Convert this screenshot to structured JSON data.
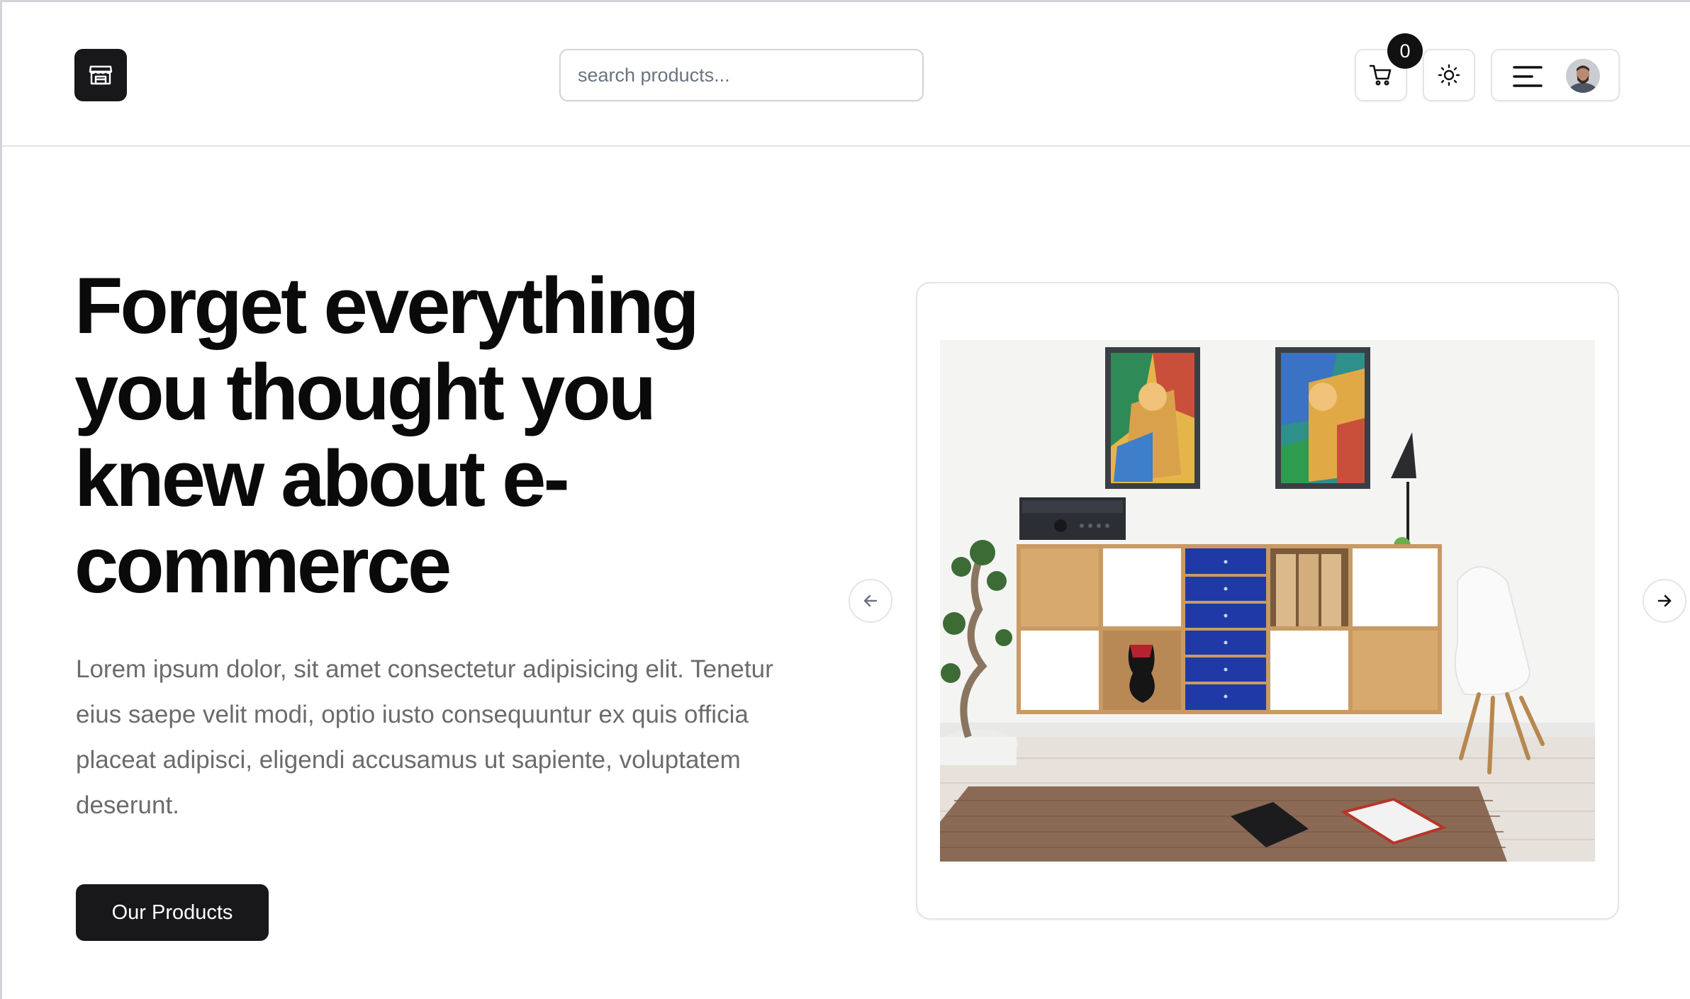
{
  "header": {
    "logo_icon": "store-icon",
    "search": {
      "placeholder": "search products...",
      "value": ""
    },
    "cart": {
      "icon": "cart-icon",
      "count": "0"
    },
    "theme_toggle": {
      "icon": "sun-icon"
    },
    "menu": {
      "icon": "menu-icon",
      "avatar": "user-avatar"
    }
  },
  "hero": {
    "headline": "Forget everything you thought you knew about e-commerce",
    "lead": "Lorem ipsum dolor, sit amet consectetur adipisicing elit. Tenetur eius saepe velit modi, optio iusto consequuntur ex quis officia placeat adipisci, eligendi accusamus ut sapiente, voluptatem deserunt.",
    "cta_label": "Our Products"
  },
  "carousel": {
    "prev_icon": "arrow-left-icon",
    "next_icon": "arrow-right-icon",
    "slide": "living-room-shelving-photo"
  },
  "colors": {
    "primary": "#18181b",
    "border": "#e4e4e7",
    "muted_text": "#6b6b6b",
    "shelf_blue": "#1f3aa6"
  }
}
